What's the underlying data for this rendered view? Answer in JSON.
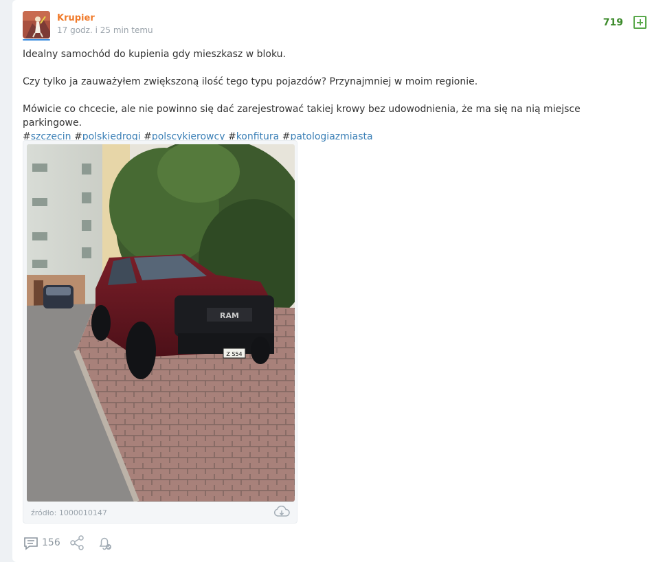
{
  "post": {
    "author": "Krupier",
    "time_ago": "17 godz. i 25 min temu",
    "votes": "719",
    "paragraphs": [
      "Idealny samochód do kupienia gdy mieszkasz w bloku.",
      "Czy tylko ja zauważyłem zwiększoną ilość tego typu pojazdów? Przynajmniej w moim regionie.",
      "Mówicie co chcecie, ale nie powinno się dać zarejestrować takiej krowy bez udowodnienia, że ma się na nią miejsce parkingowe."
    ],
    "tag_prefix": "#",
    "tags": [
      "szczecin",
      "polskiedrogi",
      "polscykierowcy",
      "konfitura",
      "patologiazmiasta"
    ],
    "media": {
      "source_text": "źródło: 1000010147",
      "photo_plate": "Z S54"
    },
    "footer": {
      "comments_count": "156"
    }
  },
  "colors": {
    "author": "#f07a2a",
    "votes": "#3b8a2a",
    "tag": "#3a7fb6"
  },
  "icons": [
    "avatar-image",
    "plus-icon",
    "download-cloud-icon",
    "comment-icon",
    "share-icon",
    "notification-bell-icon"
  ]
}
